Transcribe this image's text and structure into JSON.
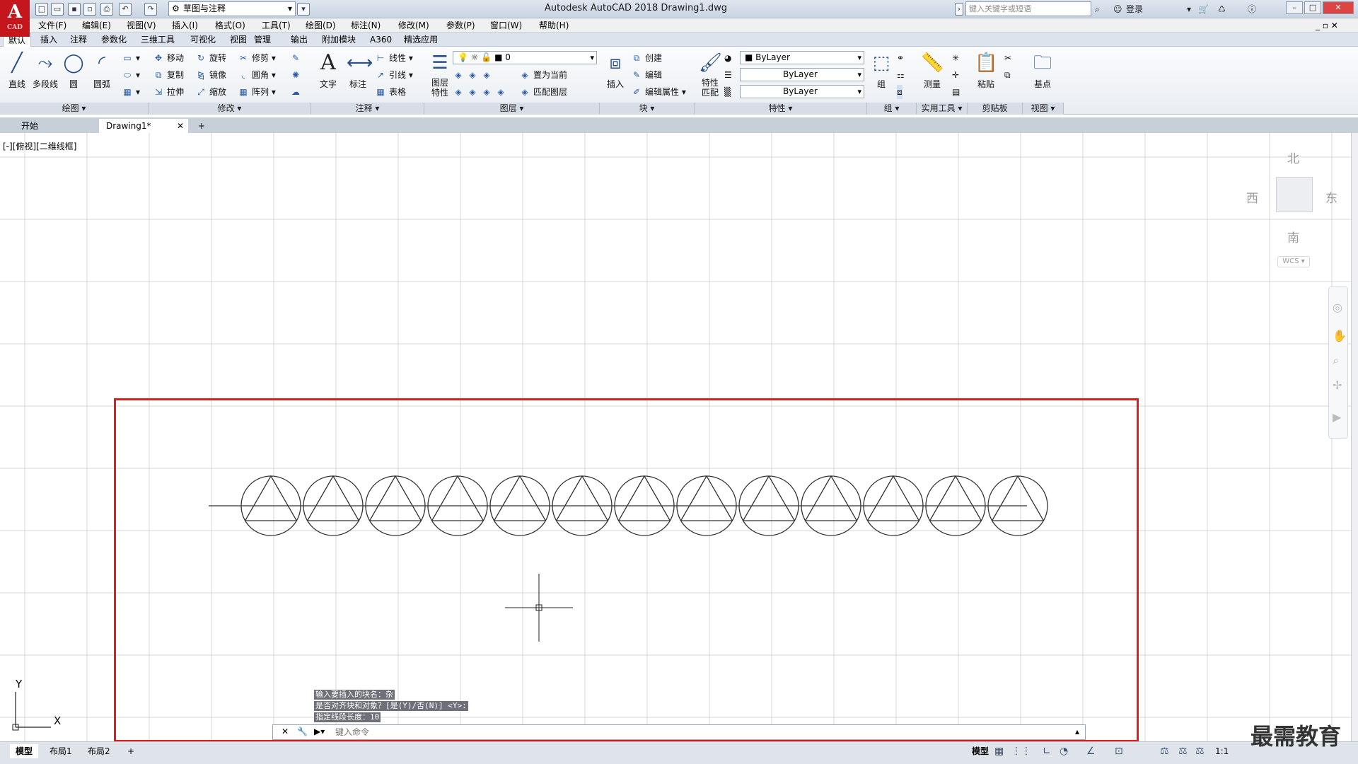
{
  "titlebar": {
    "workspace": "草图与注释",
    "title": "Autodesk AutoCAD 2018    Drawing1.dwg",
    "search_placeholder": "键入关键字或短语",
    "login": "登录"
  },
  "menus": [
    "文件(F)",
    "编辑(E)",
    "视图(V)",
    "插入(I)",
    "格式(O)",
    "工具(T)",
    "绘图(D)",
    "标注(N)",
    "修改(M)",
    "参数(P)",
    "窗口(W)",
    "帮助(H)"
  ],
  "ribbon_tabs": [
    "默认",
    "插入",
    "注释",
    "参数化",
    "三维工具",
    "可视化",
    "视图",
    "管理",
    "输出",
    "附加模块",
    "A360",
    "精选应用"
  ],
  "ribbon": {
    "draw": {
      "title": "绘图",
      "line": "直线",
      "polyline": "多段线",
      "circle": "圆",
      "arc": "圆弧"
    },
    "modify": {
      "title": "修改",
      "move": "移动",
      "rotate": "旋转",
      "trim": "修剪",
      "copy": "复制",
      "mirror": "镜像",
      "fillet": "圆角",
      "stretch": "拉伸",
      "scale": "缩放",
      "array": "阵列"
    },
    "annotate": {
      "title": "注释",
      "text": "文字",
      "dimension": "标注",
      "linear": "线性",
      "leader": "引线",
      "table": "表格"
    },
    "layers": {
      "title": "图层",
      "props": "图层特性",
      "layer_value": "0",
      "set_current": "置为当前",
      "match": "匹配图层"
    },
    "block": {
      "title": "块",
      "insert": "插入",
      "create": "创建",
      "edit": "编辑",
      "edit_attr": "编辑属性"
    },
    "properties": {
      "title": "特性",
      "match": "特性匹配",
      "color": "ByLayer",
      "linetype": "ByLayer",
      "lineweight": "ByLayer"
    },
    "group": {
      "title": "组",
      "group": "组"
    },
    "utilities": {
      "title": "实用工具",
      "measure": "测量"
    },
    "clipboard": {
      "title": "剪贴板",
      "paste": "粘贴"
    },
    "view": {
      "title": "视图",
      "base": "基点"
    }
  },
  "doc_tabs": {
    "start": "开始",
    "drawing": "Drawing1*"
  },
  "viewport": {
    "label": "[-][俯视][二维线框]",
    "compass": {
      "north": "北",
      "south": "南",
      "east": "东",
      "west": "西",
      "wcs": "WCS"
    },
    "ucs": {
      "x": "X",
      "y": "Y"
    }
  },
  "command": {
    "history": [
      "输入要插入的块名：杂",
      "是否对齐块和对象？[是(Y)/否(N)] <Y>:",
      "指定线段长度：10"
    ],
    "placeholder": "键入命令"
  },
  "status": {
    "tabs": [
      "模型",
      "布局1",
      "布局2"
    ],
    "model": "模型",
    "scale": "1:1"
  },
  "watermark": "最需教育",
  "drawing": {
    "block_count": 13,
    "segment_length": 10
  }
}
